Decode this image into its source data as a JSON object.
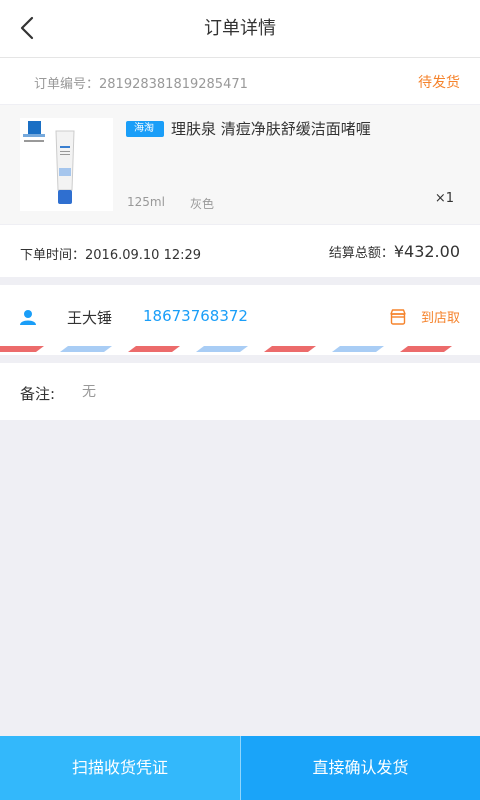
{
  "nav": {
    "title": "订单详情",
    "back_icon": "back-chevron-icon"
  },
  "order": {
    "number_label": "订单编号：281928381819285471",
    "status": "待发货"
  },
  "item": {
    "tag": "海淘",
    "name": "理肤泉 清痘净肤舒缓洁面啫喱",
    "spec_size": "125ml",
    "spec_color": "灰色",
    "quantity": "×1"
  },
  "summary": {
    "time_label": "下单时间：2016.09.10  12:29",
    "total_label": "结算总额：",
    "total_value": "¥432.00"
  },
  "customer": {
    "name": "王大锤",
    "phone": "18673768372",
    "pickup": "到店取",
    "user_icon": "user-icon",
    "store_icon": "store-icon"
  },
  "remark": {
    "label": "备注:",
    "value": "无"
  },
  "actions": {
    "scan": "扫描收货凭证",
    "confirm": "直接确认发货"
  },
  "colors": {
    "accent_blue": "#1a9ef8",
    "accent_orange": "#f5832c",
    "stripe_red": "#ec6b6b",
    "stripe_blue": "#a9cdf5"
  }
}
